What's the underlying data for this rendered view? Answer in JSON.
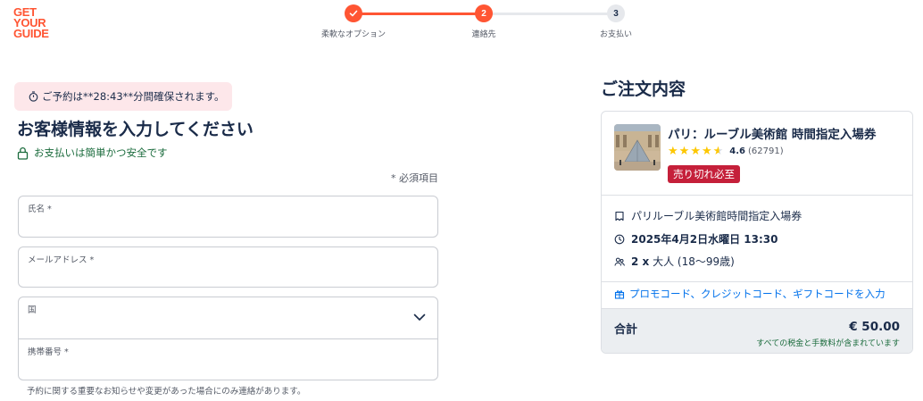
{
  "logo": {
    "line1": "GET",
    "line2": "YOUR",
    "line3": "GUIDE"
  },
  "stepper": {
    "steps": [
      {
        "label": "柔軟なオプション",
        "number": "1",
        "status": "done"
      },
      {
        "label": "連絡先",
        "number": "2",
        "status": "current"
      },
      {
        "label": "お支払い",
        "number": "3",
        "status": "pending"
      }
    ]
  },
  "timer": {
    "text": "ご予約は**28:43**分間確保されます。"
  },
  "form": {
    "title": "お客様情報を入力してください",
    "secure_text": "お支払いは簡単かつ安全です",
    "required_note": "* 必須項目",
    "fields": {
      "name": {
        "label": "氏名 *",
        "value": ""
      },
      "email": {
        "label": "メールアドレス *",
        "value": ""
      },
      "country": {
        "label": "国",
        "value": ""
      },
      "phone": {
        "label": "携帯番号 *",
        "value": ""
      }
    },
    "phone_note": "予約に関する重要なお知らせや変更があった場合にのみ連絡があります。"
  },
  "summary": {
    "title": "ご注文内容",
    "product": {
      "title": "パリ：ルーブル美術館 時間指定入場券",
      "rating": "4.6",
      "rating_value": 4.6,
      "review_count": "(62791)",
      "badge": "売り切れ必至"
    },
    "details": {
      "ticket": "パリルーブル美術館時間指定入場券",
      "datetime": "2025年4月2日水曜日 13:30",
      "participants_count": "2 x",
      "participants_type": "大人 (18〜99歳)"
    },
    "promo": "プロモコード、クレジットコード、ギフトコードを入力",
    "total_label": "合計",
    "total_value": "€ 50.00",
    "tax_note": "すべての税金と手数料が含まれています"
  },
  "colors": {
    "brand": "#ff5533",
    "text": "#1a2b49",
    "link": "#0071eb",
    "success": "#1a6b3c",
    "badge": "#c5203a",
    "timer_bg": "#fde7ea"
  }
}
